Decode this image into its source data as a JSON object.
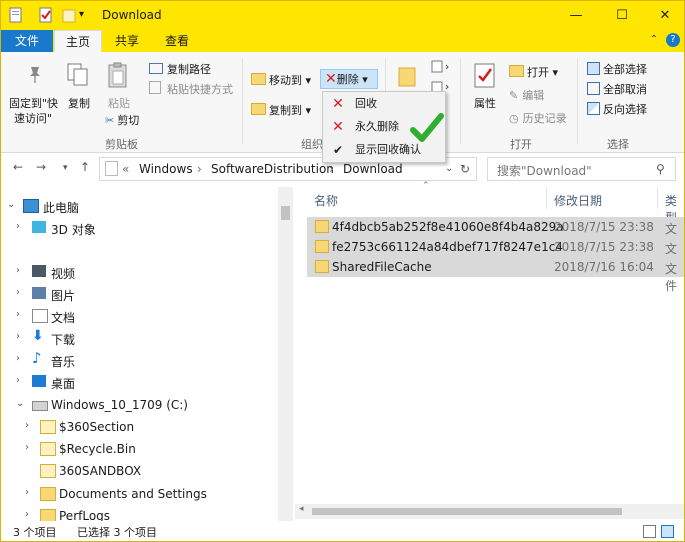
{
  "window": {
    "title": "Download"
  },
  "tabs": {
    "file": "文件",
    "home": "主页",
    "share": "共享",
    "view": "查看"
  },
  "ribbon": {
    "clipboard": {
      "pin_line1": "固定到\"快",
      "pin_line2": "速访问\"",
      "copy": "复制",
      "paste": "粘贴",
      "copy_path": "复制路径",
      "paste_shortcut": "粘贴快捷方式",
      "cut": "剪切",
      "group_label": "剪贴板"
    },
    "organize": {
      "move_to": "移动到",
      "copy_to": "复制到",
      "delete": "删除",
      "group_label": "组织"
    },
    "open": {
      "properties": "属性",
      "open": "打开",
      "edit": "编辑",
      "history": "历史记录",
      "group_label": "打开"
    },
    "select": {
      "select_all": "全部选择",
      "select_none": "全部取消",
      "invert": "反向选择",
      "group_label": "选择"
    }
  },
  "delete_menu": {
    "recycle": "回收",
    "permanent": "永久删除",
    "show_confirm": "显示回收确认"
  },
  "address": {
    "root": "Windows",
    "folder1": "SoftwareDistribution",
    "folder2": "Download"
  },
  "search": {
    "placeholder": "搜索\"Download\""
  },
  "nav_tree": {
    "this_pc": "此电脑",
    "objects3d": "3D 对象",
    "videos": "视频",
    "pictures": "图片",
    "documents": "文档",
    "downloads": "下载",
    "music": "音乐",
    "desktop": "桌面",
    "drive": "Windows_10_1709 (C:)",
    "sec360": "$360Section",
    "recycle": "$Recycle.Bin",
    "sandbox": "360SANDBOX",
    "docs_settings": "Documents and Settings",
    "perflogs": "PerfLogs"
  },
  "columns": {
    "name": "名称",
    "modified": "修改日期",
    "type": "类型"
  },
  "files": [
    {
      "name": "4f4dbcb5ab252f8e41060e8f4b4a829a",
      "date": "2018/7/15 23:38",
      "type": "文件"
    },
    {
      "name": "fe2753c661124a84dbef717f8247e1c4",
      "date": "2018/7/15 23:38",
      "type": "文件"
    },
    {
      "name": "SharedFileCache",
      "date": "2018/7/16 16:04",
      "type": "文件"
    }
  ],
  "status": {
    "count": "3 个项目",
    "selected": "已选择 3 个项目"
  },
  "colors": {
    "accent": "#ffe600",
    "file_tab": "#1979ca",
    "selection": "#d9d9d9",
    "delete_red": "#d41f1f",
    "check_green": "#2fae2f"
  }
}
